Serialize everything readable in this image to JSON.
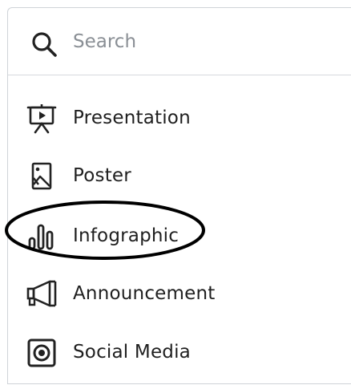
{
  "search": {
    "placeholder": "Search",
    "icon": "search-icon"
  },
  "items": [
    {
      "label": "Presentation",
      "icon": "presentation-icon"
    },
    {
      "label": "Poster",
      "icon": "poster-icon"
    },
    {
      "label": "Infographic",
      "icon": "infographic-icon",
      "highlighted": true
    },
    {
      "label": "Announcement",
      "icon": "megaphone-icon"
    },
    {
      "label": "Social Media",
      "icon": "social-media-icon"
    }
  ],
  "colors": {
    "text": "#1f1f1f",
    "placeholder": "#8a8f95",
    "border": "#cfd3d8",
    "highlight": "#000000"
  }
}
